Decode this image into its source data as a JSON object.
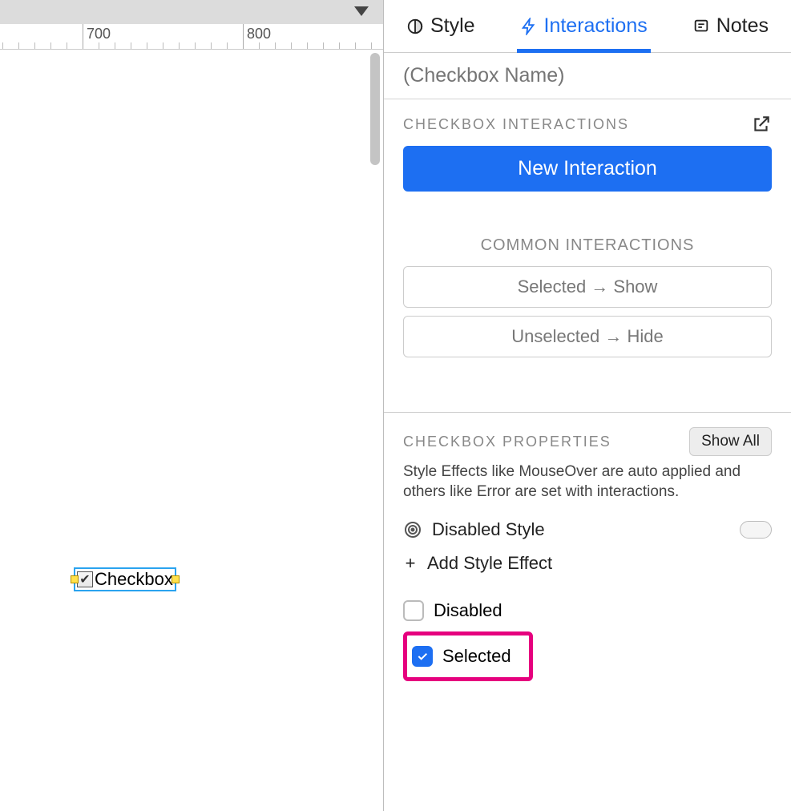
{
  "ruler": {
    "marks": [
      "700",
      "800"
    ]
  },
  "canvas_widget": {
    "label": "Checkbox"
  },
  "tabs": {
    "style": "Style",
    "interactions": "Interactions",
    "notes": "Notes"
  },
  "name_field": {
    "placeholder": "(Checkbox Name)"
  },
  "interactions_section": {
    "header": "CHECKBOX INTERACTIONS",
    "new_button": "New Interaction",
    "common_header": "COMMON INTERACTIONS",
    "common_buttons": [
      "Selected → Show",
      "Unselected → Hide"
    ]
  },
  "properties_section": {
    "header": "CHECKBOX PROPERTIES",
    "show_all": "Show All",
    "hint": "Style Effects like MouseOver are auto applied and others like Error are set with interactions.",
    "disabled_style": "Disabled Style",
    "add_style_effect": "Add Style Effect",
    "disabled": "Disabled",
    "selected": "Selected"
  }
}
